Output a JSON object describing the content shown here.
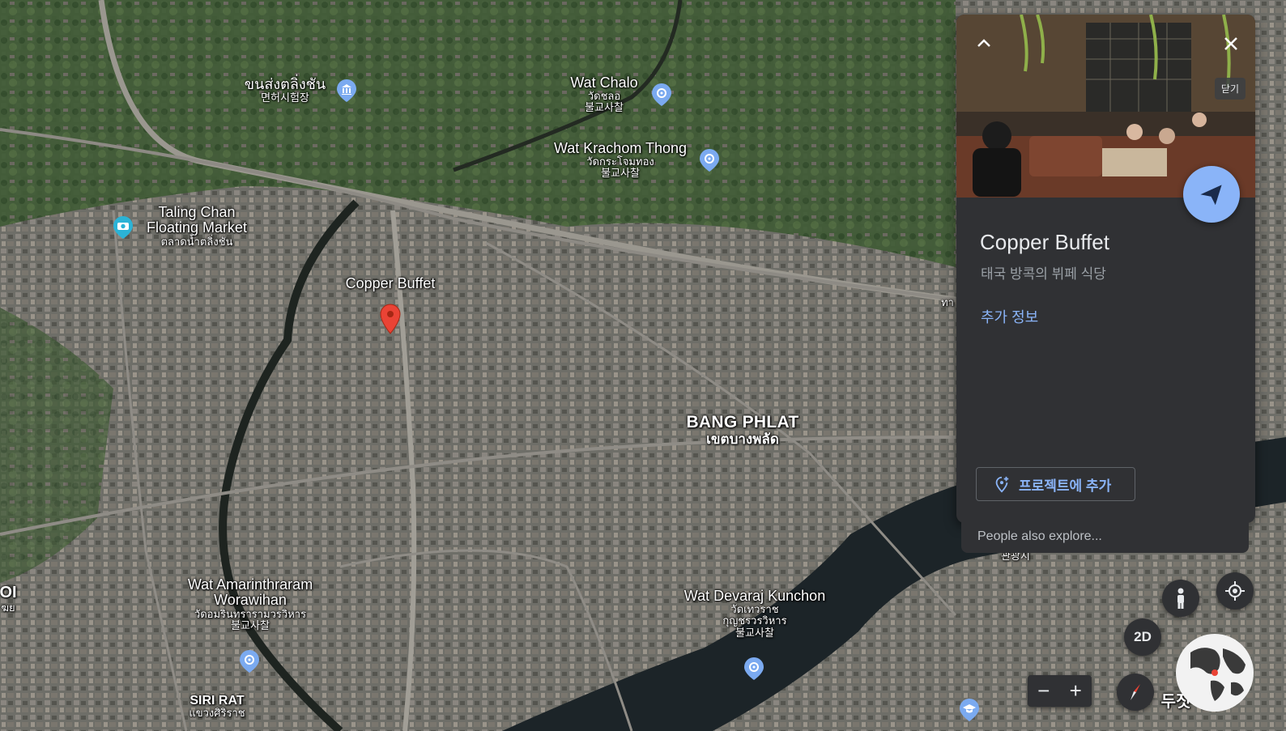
{
  "map": {
    "labels": [
      {
        "id": "khon-song",
        "main": "ขนส่งตลิ่งชัน",
        "sub": "면허시험장"
      },
      {
        "id": "wat-chalo",
        "main": "Wat Chalo",
        "sub": "วัดชลอ",
        "sub2": "불교사찰"
      },
      {
        "id": "wat-krachom",
        "main": "Wat Krachom Thong",
        "sub": "วัดกระโจมทอง",
        "sub2": "불교사찰"
      },
      {
        "id": "taling-chan",
        "main": "Taling Chan",
        "main2": "Floating Market",
        "sub": "ตลาดน้ำตลิ่งชัน"
      },
      {
        "id": "copper-buffet",
        "main": "Copper Buffet"
      },
      {
        "id": "bang-phlat",
        "main": "BANG PHLAT",
        "sub": "เขตบางพลัด"
      },
      {
        "id": "wat-amarin",
        "main": "Wat Amarinthraram",
        "main2": "Worawihan",
        "sub": "วัดอมรินทรารามวรวิหาร",
        "sub2": "불교사찰"
      },
      {
        "id": "wat-devaraj",
        "main": "Wat Devaraj Kunchon",
        "sub": "วัดเทวราช",
        "sub2": "กุญชรวรวิหาร",
        "sub3": "불교사찰"
      },
      {
        "id": "siri-rat",
        "main": "SIRI RAT",
        "sub": "แขวงศิริราช"
      },
      {
        "id": "left-edge",
        "main": "OI",
        "sub": "ฆย"
      },
      {
        "id": "right-edge-1",
        "main": "ทา"
      },
      {
        "id": "right-edge-2",
        "main": "관광지"
      },
      {
        "id": "dusit",
        "main": "두짓 구"
      }
    ],
    "icons": [
      "museum-icon",
      "buddhist-temple-icon",
      "camera-icon",
      "school-icon",
      "red-pin-icon"
    ]
  },
  "panel": {
    "title": "Copper Buffet",
    "subtitle": "태국 방콕의 뷔페 식당",
    "more_info": "추가 정보",
    "close_pill": "닫기",
    "add_project": "프로젝트에 추가",
    "people_also_explore": "People also explore..."
  },
  "controls": {
    "btn_2d": "2D",
    "zoom_out": "−",
    "zoom_in": "+"
  },
  "colors": {
    "panel_bg": "#303134",
    "accent": "#8ab4f8",
    "pin_red": "#ea4335"
  }
}
